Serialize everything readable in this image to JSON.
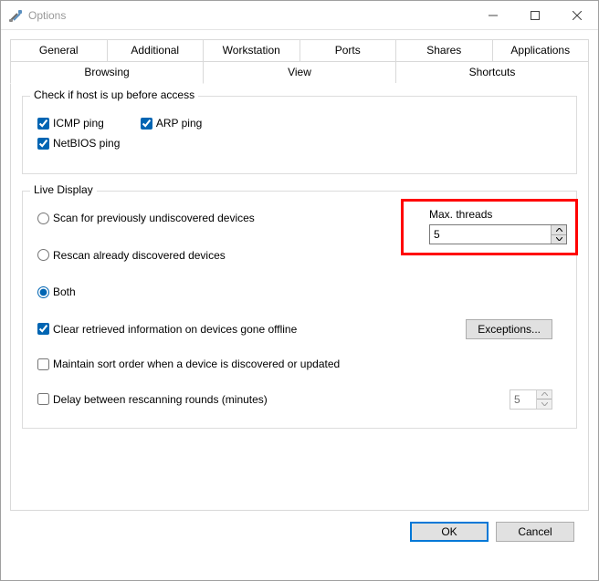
{
  "window": {
    "title": "Options"
  },
  "tabs": {
    "row1": [
      "General",
      "Additional",
      "Workstation",
      "Ports",
      "Shares",
      "Applications"
    ],
    "row2": [
      "Browsing",
      "View",
      "Shortcuts"
    ],
    "active": "Browsing"
  },
  "group_check": {
    "legend": "Check if host is up before access",
    "icmp": {
      "label": "ICMP ping",
      "checked": true
    },
    "arp": {
      "label": "ARP ping",
      "checked": true
    },
    "netbios": {
      "label": "NetBIOS ping",
      "checked": true
    }
  },
  "group_live": {
    "legend": "Live Display",
    "radio_scan": "Scan for previously undiscovered devices",
    "radio_rescan": "Rescan already discovered devices",
    "radio_both": "Both",
    "radio_selected": "both",
    "max_threads_label": "Max. threads",
    "max_threads_value": "5",
    "clear_offline": {
      "label": "Clear retrieved information on devices gone offline",
      "checked": true
    },
    "maintain_sort": {
      "label": "Maintain sort order when a device is discovered or updated",
      "checked": false
    },
    "delay_rescan": {
      "label": "Delay between rescanning rounds (minutes)",
      "checked": false,
      "value": "5"
    },
    "exceptions_btn": "Exceptions..."
  },
  "footer": {
    "ok": "OK",
    "cancel": "Cancel"
  }
}
